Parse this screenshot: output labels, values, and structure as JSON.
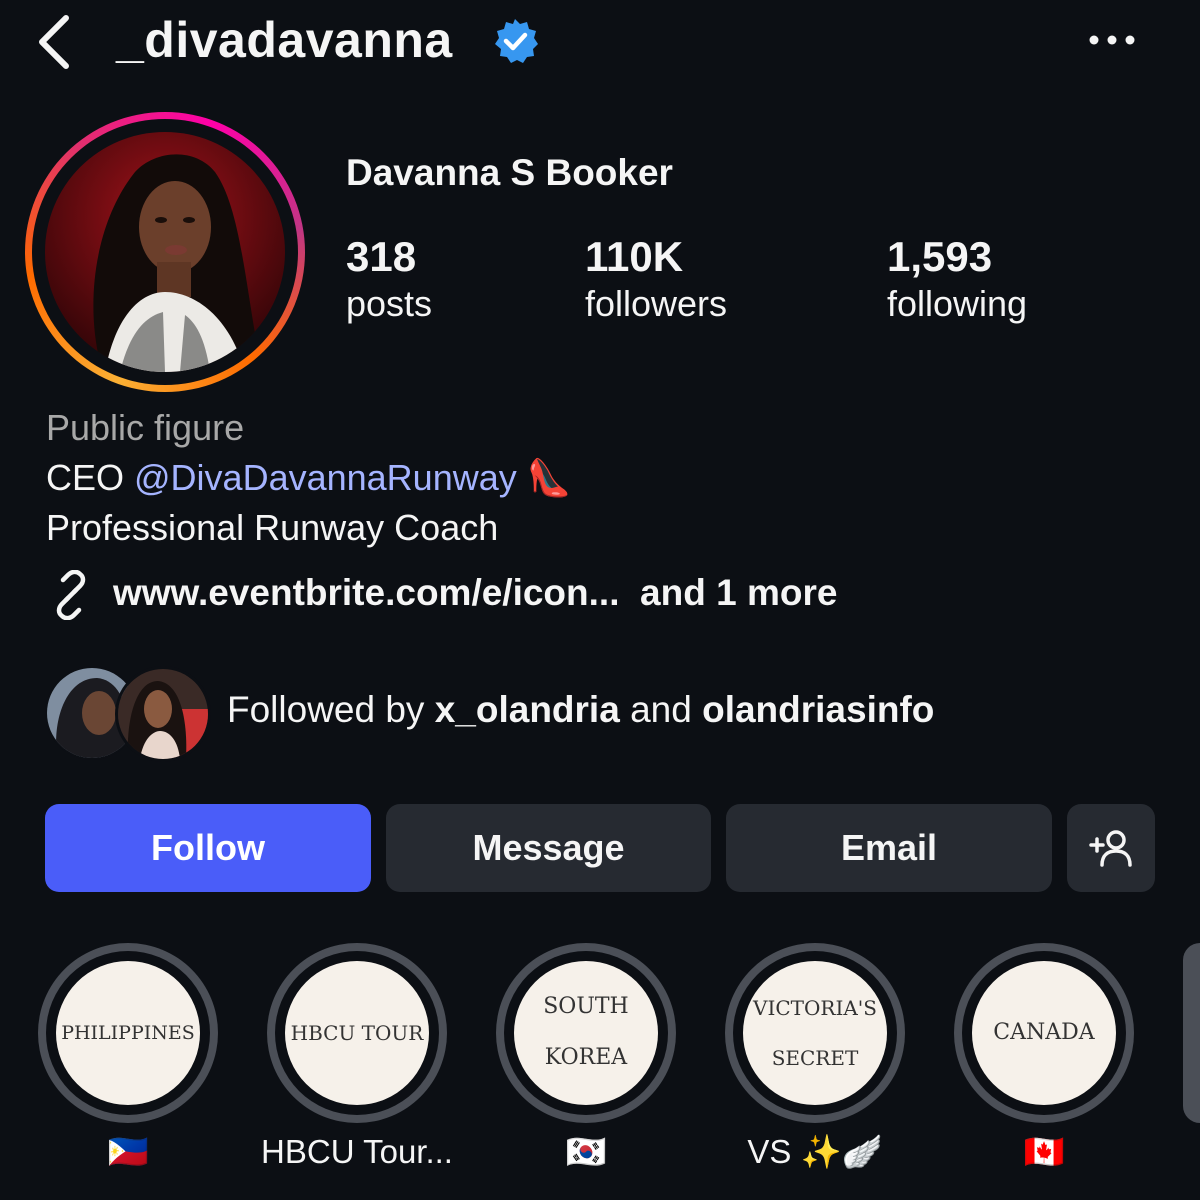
{
  "header": {
    "username": "_divadavanna",
    "verified": true,
    "back_icon": "chevron-left-icon",
    "more_icon": "more-horizontal-icon"
  },
  "profile": {
    "full_name": "Davanna S Booker",
    "stats": {
      "posts": {
        "value": "318",
        "label": "posts"
      },
      "followers": {
        "value": "110K",
        "label": "followers"
      },
      "following": {
        "value": "1,593",
        "label": "following"
      }
    },
    "category": "Public figure",
    "bio": {
      "line1_prefix": "CEO ",
      "line1_mention": "@DivaDavannaRunway",
      "line1_emoji": "👠",
      "line2": "Professional Runway Coach"
    },
    "link": {
      "url": "www.eventbrite.com/e/icon...",
      "more": "and 1 more"
    }
  },
  "followed_by": {
    "prefix": "Followed by ",
    "user1": "x_olandria",
    "joiner": " and ",
    "user2": "olandriasinfo"
  },
  "actions": {
    "follow": "Follow",
    "message": "Message",
    "email": "Email",
    "add_user_icon": "add-person-icon"
  },
  "highlights": [
    {
      "cover_lines": [
        "PHILIPPINES"
      ],
      "label": "🇵🇭"
    },
    {
      "cover_lines": [
        "HBCU TOUR"
      ],
      "label": "HBCU Tour..."
    },
    {
      "cover_lines": [
        "SOUTH",
        "KOREA"
      ],
      "label": "🇰🇷"
    },
    {
      "cover_lines": [
        "VICTORIA'S",
        "SECRET"
      ],
      "label": "VS ✨🪽"
    },
    {
      "cover_lines": [
        "CANADA"
      ],
      "label": "🇨🇦"
    }
  ],
  "colors": {
    "background": "#0c0f14",
    "follow_button": "#4a5df9",
    "secondary_button": "#262a31",
    "mention": "#a5b4ff",
    "verified": "#3797f0"
  }
}
